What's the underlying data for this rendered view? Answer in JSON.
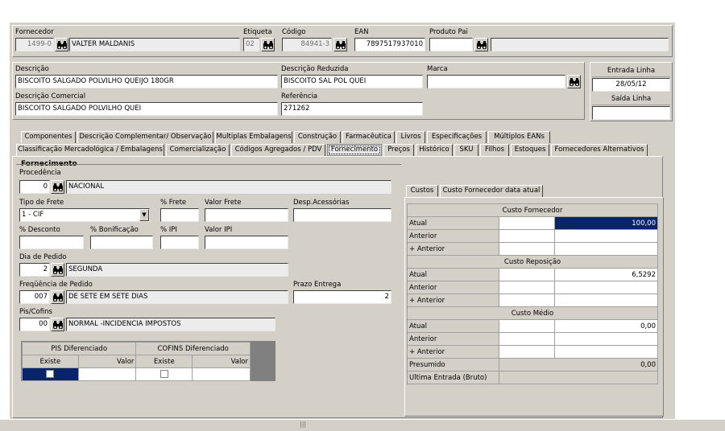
{
  "supplier": {
    "fornecedor_label": "Fornecedor",
    "fornecedor_code": "1499-0",
    "fornecedor_name": "VALTER MALDANIS",
    "etiqueta_label": "Etiqueta",
    "etiqueta_value": "02",
    "codigo_label": "Código",
    "codigo_value": "84941-3",
    "ean_label": "EAN",
    "ean_value": "7897517937010",
    "produto_pai_label": "Produto Pai",
    "produto_pai_value": "",
    "produto_pai_name": ""
  },
  "product": {
    "descricao_label": "Descrição",
    "descricao_value": "BISCOITO SALGADO POLVILHO QUEIJO 180GR",
    "desc_reduzida_label": "Descrição Reduzida",
    "desc_reduzida_value": "BISCOITO SAL POL QUEI",
    "marca_label": "Marca",
    "marca_value": "",
    "desc_comercial_label": "Descrição Comercial",
    "desc_comercial_value": "BISCOITO SALGADO POLVILHO QUEI",
    "referencia_label": "Referência",
    "referencia_value": "271262",
    "entrada_linha_label": "Entrada Linha",
    "entrada_linha_value": "28/05/12",
    "saida_linha_label": "Saída Linha",
    "saida_linha_value": ""
  },
  "tabs_row1": [
    "Componentes",
    "Descrição Complementar/ Observação",
    "Multiplas Embalagens",
    "Construção",
    "Farmacêutica",
    "Livros",
    "Especificações",
    "Múltiplos EANs"
  ],
  "tabs_row2": [
    "Classificação Mercadológica / Embalagens",
    "Comercialização",
    "Códigos Agregados / PDV",
    "Fornecimento",
    "Preços",
    "Histórico",
    "SKU",
    "Filhos",
    "Estoques",
    "Fornecedores Alternativos"
  ],
  "fornecimento": {
    "group_title": "Fornecimento",
    "procedencia_label": "Procedência",
    "procedencia_code": "0",
    "procedencia_name": "NACIONAL",
    "tipo_frete_label": "Tipo de Frete",
    "tipo_frete_value": "1 - CIF",
    "pct_frete_label": "% Frete",
    "valor_frete_label": "Valor Frete",
    "desp_acessorias_label": "Desp.Acessórias",
    "pct_desconto_label": "% Desconto",
    "pct_bonificacao_label": "% Bonificação",
    "pct_ipi_label": "% IPI",
    "valor_ipi_label": "Valor IPI",
    "dia_pedido_label": "Dia de Pedido",
    "dia_pedido_code": "2",
    "dia_pedido_name": "SEGUNDA",
    "frequencia_label": "Freqüência de Pedido",
    "frequencia_code": "007",
    "frequencia_name": "DE SETE EM SETE DIAS",
    "prazo_label": "Prazo Entrega",
    "prazo_value": "2",
    "pis_label": "Pis/Cofins",
    "pis_code": "00",
    "pis_name": "NORMAL -INCIDENCIA IMPOSTOS",
    "pis_grid": {
      "pis_header": "PIS Diferenciado",
      "cofins_header": "COFINS Diferenciado",
      "existe": "Existe",
      "valor": "Valor"
    }
  },
  "custos": {
    "tabs": [
      "Custos",
      "Custo Fornecedor data atual"
    ],
    "sections": [
      {
        "title": "Custo Fornecedor",
        "rows": [
          {
            "label": "Atual",
            "value": "100,00"
          },
          {
            "label": "Anterior",
            "value": ""
          },
          {
            "label": "+ Anterior",
            "value": ""
          }
        ]
      },
      {
        "title": "Custo Reposição",
        "rows": [
          {
            "label": "Atual",
            "value": "6,5292"
          },
          {
            "label": "Anterior",
            "value": ""
          },
          {
            "label": "+ Anterior",
            "value": ""
          }
        ]
      },
      {
        "title": "Custo Médio",
        "rows": [
          {
            "label": "Atual",
            "value": "0,00"
          },
          {
            "label": "Anterior",
            "value": ""
          },
          {
            "label": "+ Anterior",
            "value": ""
          },
          {
            "label": "Presumido",
            "value": "0,00"
          },
          {
            "label": "Ultima Entrada (Bruto)",
            "value": ""
          }
        ]
      }
    ]
  },
  "statusbar": {
    "grip": "|||"
  }
}
